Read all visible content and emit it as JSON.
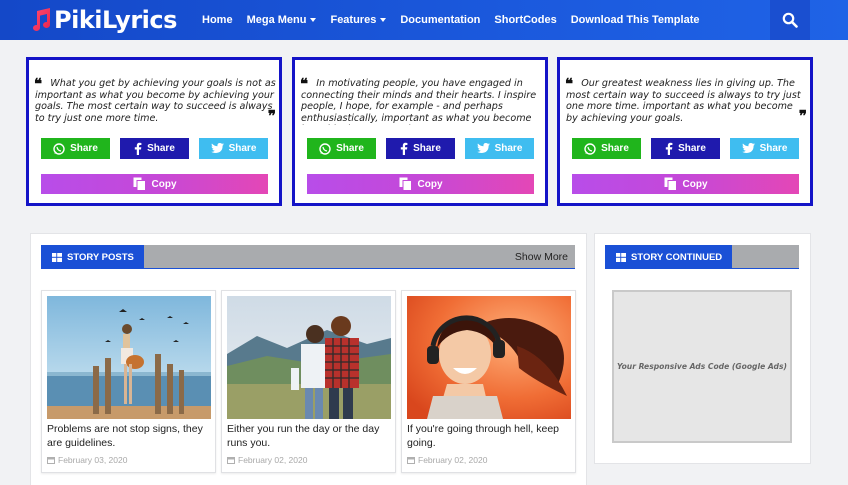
{
  "header": {
    "logo_text": "PikiLyrics",
    "nav": [
      {
        "label": "Home",
        "dropdown": false
      },
      {
        "label": "Mega Menu",
        "dropdown": true
      },
      {
        "label": "Features",
        "dropdown": true
      },
      {
        "label": "Documentation",
        "dropdown": false
      },
      {
        "label": "ShortCodes",
        "dropdown": false
      },
      {
        "label": "Download This Template",
        "dropdown": false
      }
    ],
    "search_icon": "search-icon"
  },
  "quotes": [
    {
      "text": "What you get by achieving your goals is not as important as what you become by achieving your goals. The most certain way to succeed is always to try just one more time."
    },
    {
      "text": "In motivating people, you have engaged in connecting their minds and their hearts. I inspire people, I hope, for example - and perhaps enthusiastically, important as what you become by achieving your goals."
    },
    {
      "text": "Our greatest weakness lies in giving up. The most certain way to succeed is always to try just one more time. important as what you become by achieving your goals."
    }
  ],
  "share": {
    "whatsapp": "Share",
    "facebook": "Share",
    "twitter": "Share",
    "copy": "Copy"
  },
  "story_posts": {
    "heading": "STORY POSTS",
    "show_more": "Show More",
    "posts": [
      {
        "title": "Problems are not stop signs, they are guidelines.",
        "date": "February 03, 2020"
      },
      {
        "title": "Either you run the day or the day runs you.",
        "date": "February 02, 2020"
      },
      {
        "title": "If you're going through hell, keep going.",
        "date": "February 02, 2020"
      }
    ]
  },
  "story_continued": {
    "heading": "STORY CONTINUED",
    "ads_text": "Your Responsive Ads Code (Google Ads)"
  },
  "colors": {
    "header": "#1b59dd",
    "card_border": "#1414c7",
    "whatsapp": "#20b51c",
    "facebook": "#1f1aad",
    "twitter": "#3fbdf0",
    "copy_gradient_start": "#b84de9",
    "copy_gradient_end": "#e447b6",
    "section_accent": "#1a50d6"
  }
}
